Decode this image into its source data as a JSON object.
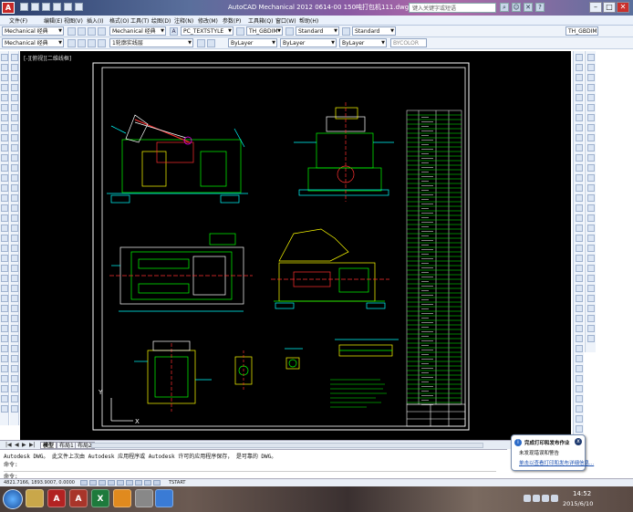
{
  "window": {
    "title": "AutoCAD Mechanical 2012    0614-00 150吨打包机111.dwg",
    "search_placeholder": "键入关键字或短语"
  },
  "menu": [
    "文件(F)",
    "编辑(E)",
    "视图(V)",
    "插入(I)",
    "格式(O)",
    "工具(T)",
    "绘图(D)",
    "注释(N)",
    "修改(M)",
    "参数(P)",
    "工具箱(Q)",
    "窗口(W)",
    "帮助(H)"
  ],
  "toolbar1": {
    "workspace": "Mechanical 经典",
    "text_style": "PC_TEXTSTYLE",
    "dim_style": "TH_GBDIM",
    "table_style": "Standard",
    "multileader_style": "Standard",
    "extra_style": "TH_GBDIM"
  },
  "toolbar2": {
    "layer_group": "Mechanical 经典",
    "layer": "1轮廓实线层",
    "color": "ByLayer",
    "linetype": "ByLayer",
    "lineweight": "ByLayer",
    "plotstyle": "BYCOLOR"
  },
  "drawing": {
    "view_label": "[-][俯视][二维线框]"
  },
  "layout_tabs": [
    "模型",
    "布局1",
    "布局2"
  ],
  "command_line": {
    "history": "Autodesk DWG。 此文件上次由 Autodesk 应用程序或 Autodesk 许可的应用程序保存， 是可靠的 DWG。",
    "prompt1": "命令:",
    "prompt2": "命令:"
  },
  "status": {
    "coordinates": "4821.7166, 1893.9007, 0.0000",
    "button_label": "TSTART"
  },
  "notification": {
    "title": "完成打印和发布作业",
    "text": "未发现错误和警告",
    "link": "单击以查看打印和发布详细信息..."
  },
  "clock": {
    "time": "14:52",
    "date": "2015/6/10"
  },
  "colors": {
    "drawing_bg": "#000000",
    "green": "#00ff00",
    "cyan": "#00ffff",
    "magenta": "#ff00ff",
    "red": "#ff3030",
    "yellow": "#ffff00",
    "white": "#ffffff"
  }
}
